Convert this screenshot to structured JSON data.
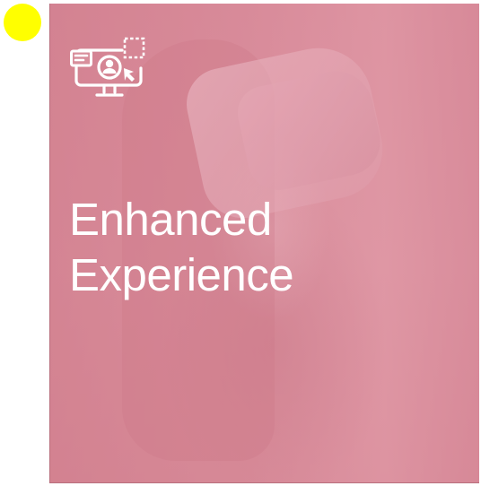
{
  "card": {
    "icon": "monitor-user-cursor-icon",
    "title_line1": "Enhanced",
    "title_line2": "Experience"
  },
  "colors": {
    "overlay": "#d88f9c",
    "text": "#ffffff",
    "marker": "#ffff00"
  }
}
